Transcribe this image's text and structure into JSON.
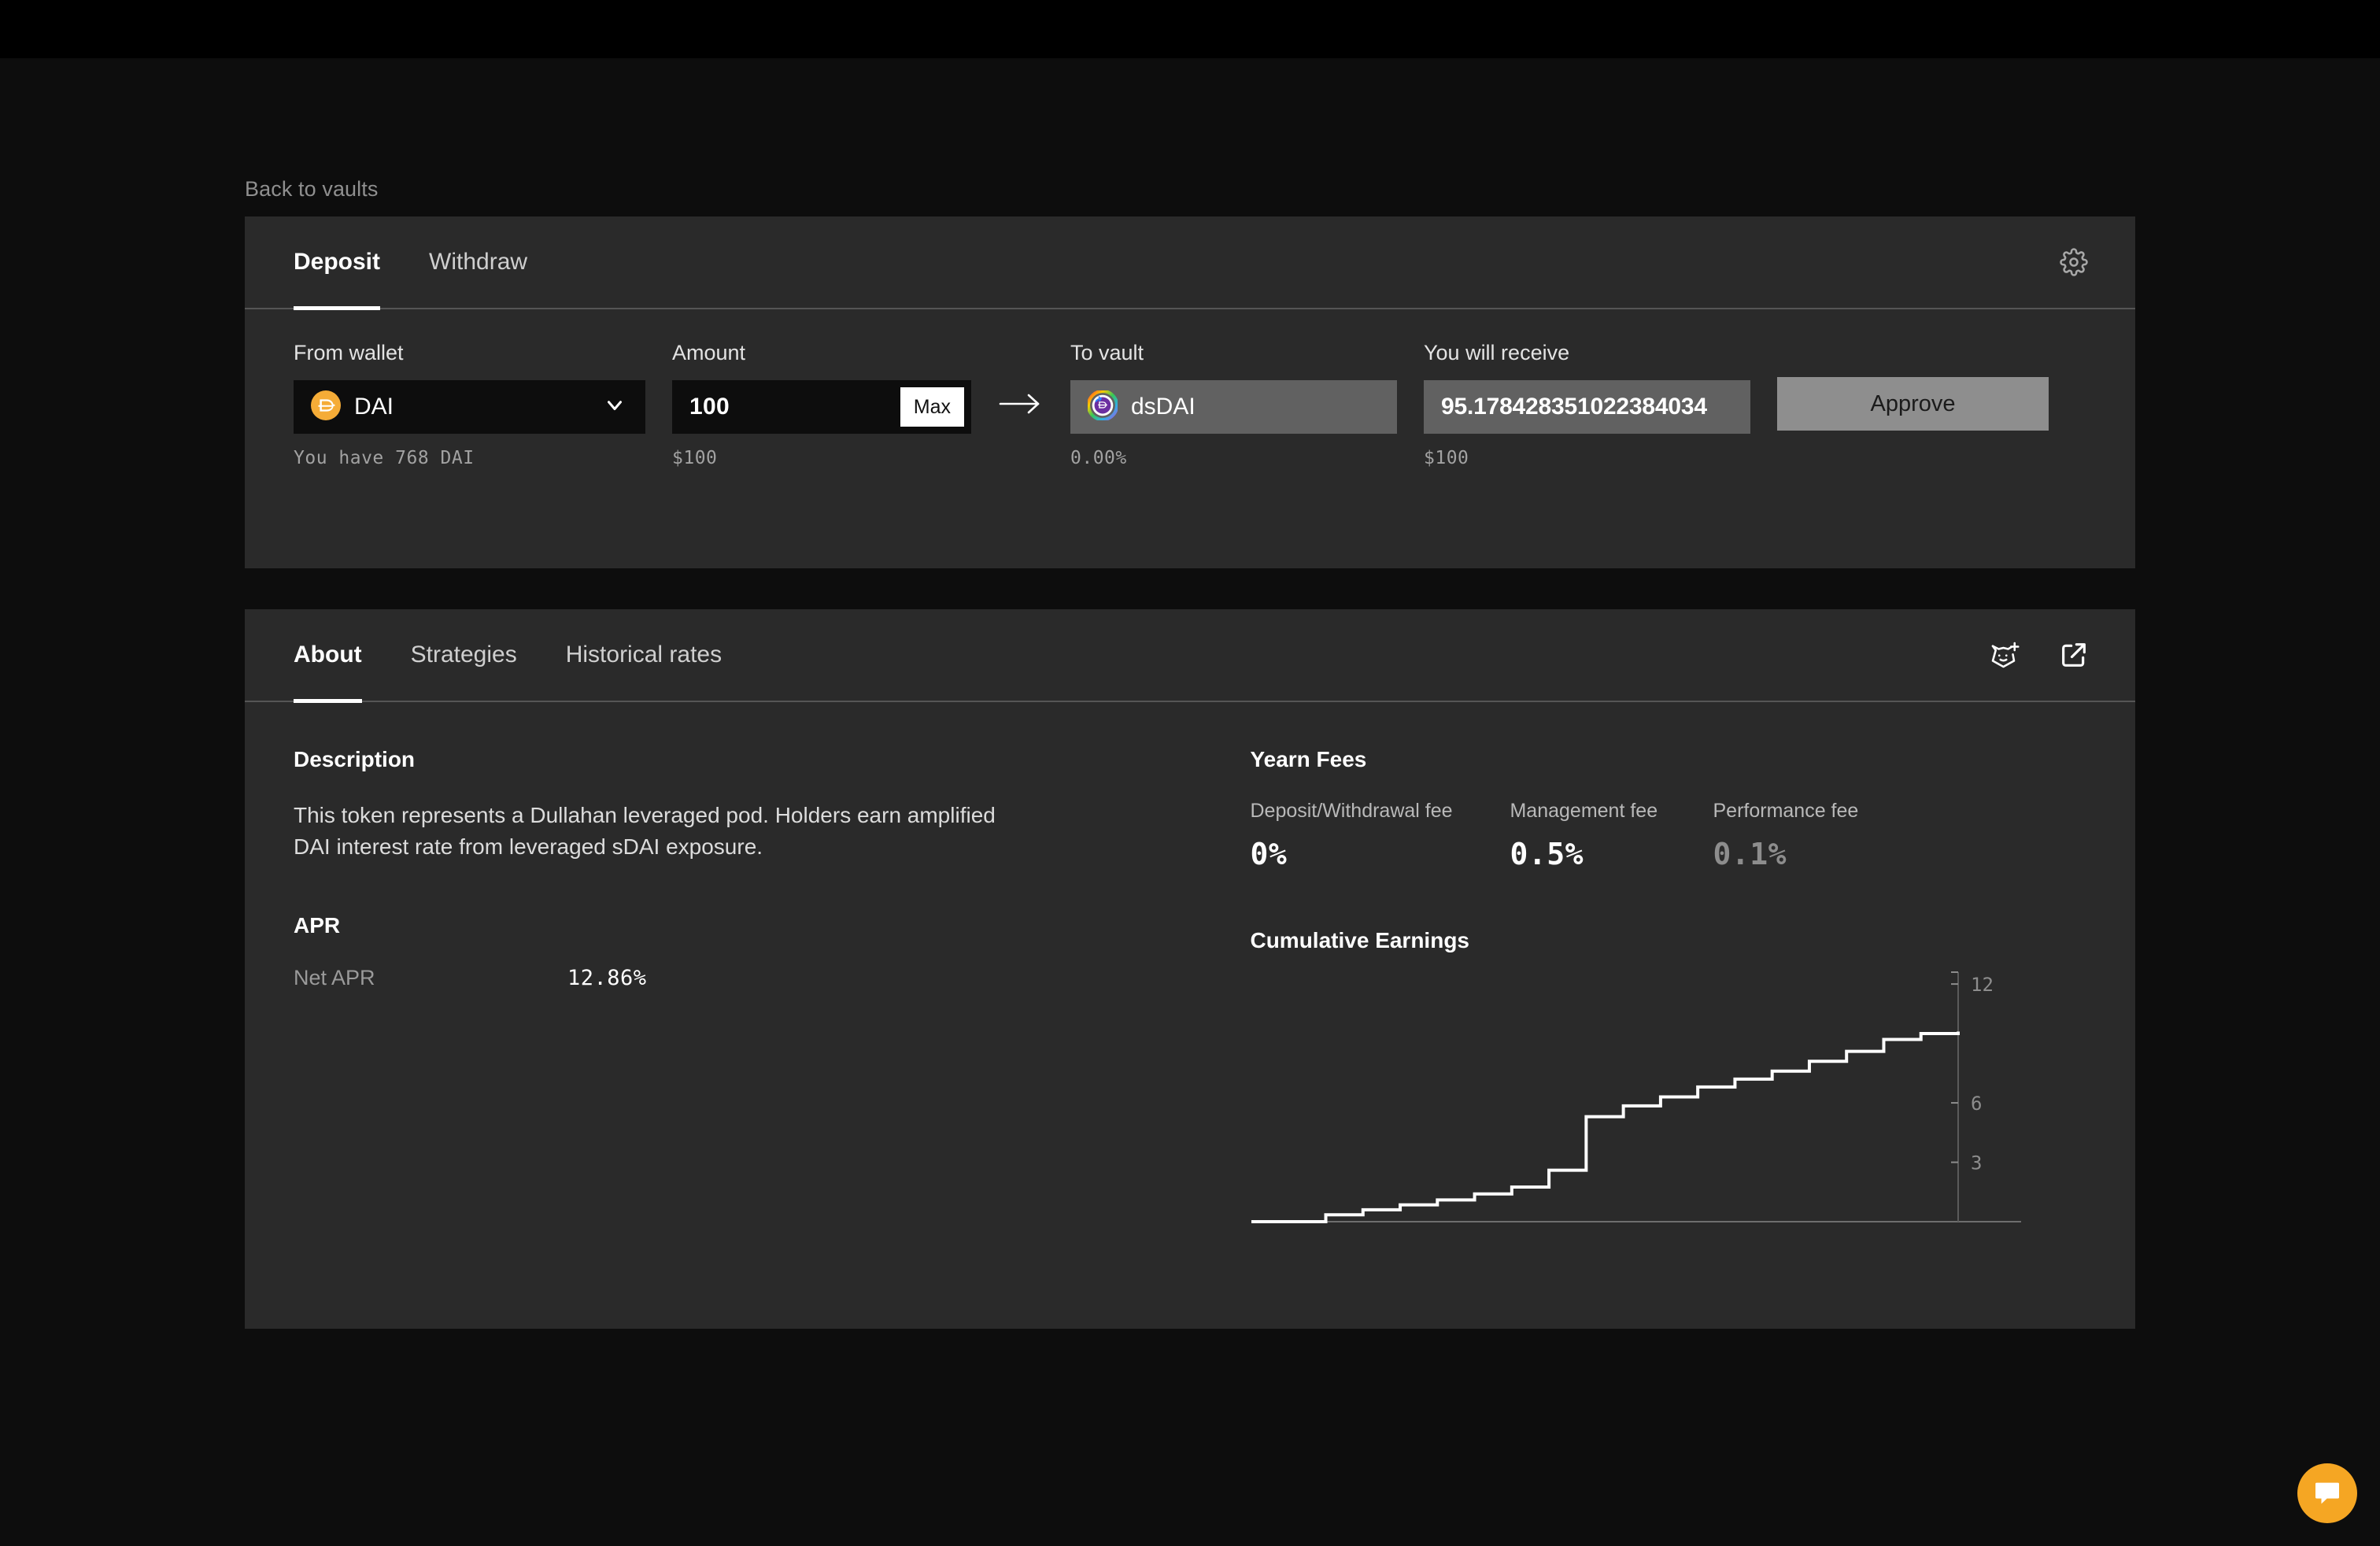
{
  "breadcrumb": {
    "label": "Back to vaults"
  },
  "form_card": {
    "tabs": [
      {
        "label": "Deposit",
        "active": true
      },
      {
        "label": "Withdraw",
        "active": false
      }
    ],
    "settings_icon": "gear-icon",
    "from_wallet": {
      "label": "From wallet",
      "token_symbol": "DAI",
      "token_icon": "dai-token-icon",
      "chevron_icon": "chevron-down-icon",
      "hint": "You have 768 DAI"
    },
    "amount": {
      "label": "Amount",
      "value": "100",
      "placeholder": "0",
      "max_label": "Max",
      "hint": "$100"
    },
    "arrow_icon": "arrow-right-icon",
    "to_vault": {
      "label": "To vault",
      "token_symbol": "dsDAI",
      "token_icon": "dsdai-token-icon",
      "hint": "0.00%"
    },
    "you_will_receive": {
      "label": "You will receive",
      "value": "95.178428351022384034",
      "hint": "$100"
    },
    "action_button": {
      "label": "Approve"
    }
  },
  "about_card": {
    "tabs": [
      {
        "label": "About",
        "active": true
      },
      {
        "label": "Strategies",
        "active": false
      },
      {
        "label": "Historical rates",
        "active": false
      }
    ],
    "actions": [
      {
        "icon": "add-to-wallet-fox-icon"
      },
      {
        "icon": "external-link-icon"
      }
    ],
    "description": {
      "title": "Description",
      "body": "This token represents a Dullahan leveraged pod. Holders earn amplified DAI interest rate from leveraged sDAI exposure."
    },
    "apr": {
      "title": "APR",
      "rows": [
        {
          "label": "Net APR",
          "value": "12.86%"
        }
      ]
    },
    "fees": {
      "title": "Yearn Fees",
      "items": [
        {
          "label": "Deposit/Withdrawal fee",
          "value": "0%",
          "muted": false
        },
        {
          "label": "Management fee",
          "value": "0.5%",
          "muted": false
        },
        {
          "label": "Performance fee",
          "value": "0.1%",
          "muted": true
        }
      ]
    },
    "earnings": {
      "title": "Cumulative Earnings"
    }
  },
  "fab": {
    "icon": "chat-bubble-icon",
    "color": "#f5a623"
  },
  "colors": {
    "page_background": "#0d0d0d",
    "top_bar": "#000000",
    "card_background": "#2a2a2a",
    "input_background": "#0d0d0d",
    "readonly_background": "#616161",
    "accent_orange": "#f5a623",
    "dai_orange": "#f5ac37",
    "button_gray": "#8e8e8e",
    "muted_text": "#8d8d8d"
  },
  "chart_data": {
    "type": "area",
    "title": "Cumulative Earnings",
    "xlabel": "",
    "ylabel": "",
    "grid": false,
    "legend": "none",
    "y_ticks": [
      3,
      6,
      12
    ],
    "ylim": [
      0,
      12.6
    ],
    "x": [
      0,
      1,
      2,
      3,
      4,
      5,
      6,
      7,
      8,
      9,
      10,
      11,
      12,
      13,
      14,
      15,
      16,
      17,
      18,
      19
    ],
    "values": [
      0,
      0,
      0.35,
      0.6,
      0.85,
      1.1,
      1.4,
      1.75,
      2.6,
      5.3,
      5.85,
      6.3,
      6.8,
      7.2,
      7.6,
      8.1,
      8.6,
      9.2,
      9.5,
      9.6
    ],
    "series": [
      {
        "name": "Cumulative Earnings",
        "values": [
          0,
          0,
          0.35,
          0.6,
          0.85,
          1.1,
          1.4,
          1.75,
          2.6,
          5.3,
          5.85,
          6.3,
          6.8,
          7.2,
          7.6,
          8.1,
          8.6,
          9.2,
          9.5,
          9.6
        ]
      }
    ]
  }
}
